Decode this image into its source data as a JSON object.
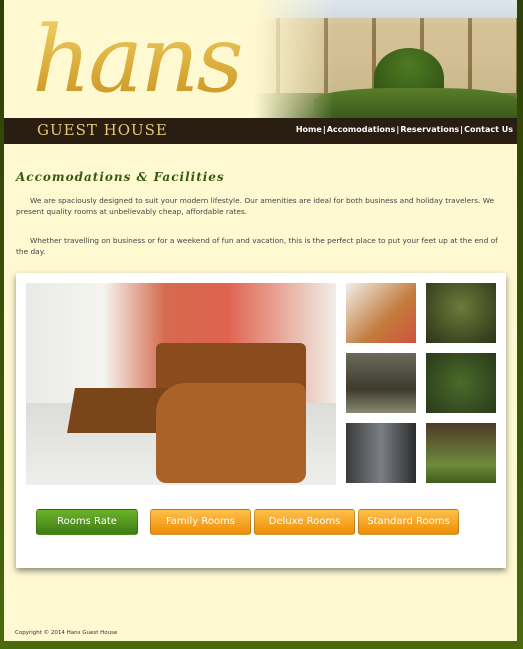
{
  "header": {
    "logo_word": "hans",
    "logo_sub": "GUEST HOUSE"
  },
  "nav": {
    "items": [
      "Home",
      "Accomodations",
      "Reservations",
      "Contact Us"
    ],
    "separator": "|"
  },
  "content": {
    "title": "Accomodations & Facilities",
    "paragraphs": [
      "We are spaciously designed to suit your modern lifestyle. Our amenities are ideal for both business and holiday travelers. We present quality rooms at unbelievably cheap, affordable rates.",
      "Whether travelling on business or for a weekend of fun and vacation, this is the perfect place to put your feet up at the end of the day."
    ]
  },
  "gallery": {
    "buttons": [
      "Rooms Rate",
      "Family Rooms",
      "Deluxe Rooms",
      "Standard Rooms"
    ]
  },
  "footer": {
    "copyright": "Copyright © 2014 Hans Guest House"
  },
  "colors": {
    "page_bg": "#fff9d2",
    "frame_green": "#3d5a0a",
    "header_bar": "#2a1e12",
    "logo_gold": "#d7a321",
    "title_green": "#355b0e",
    "button_green": "#4f9a1c",
    "button_orange": "#f5a621"
  }
}
